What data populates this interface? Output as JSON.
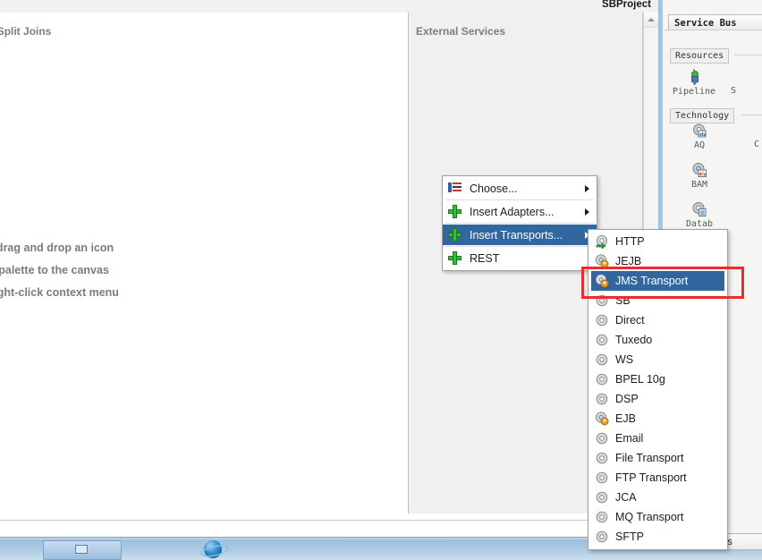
{
  "window": {
    "title": "SBProject"
  },
  "search": {
    "icon": "search-icon",
    "value": "",
    "placeholder": ""
  },
  "editor": {
    "left_column": {
      "header": "pelines/Split Joins",
      "hints": [
        "ources, drag and drop an icon",
        "mponent palette to the canvas",
        "om the right-click context menu"
      ]
    },
    "right_column": {
      "header": "External Services"
    }
  },
  "palette": {
    "tab": "Service Bus",
    "groups": [
      {
        "label": "Resources",
        "items": [
          {
            "name": "Pipeline",
            "icon": "pipeline-icon"
          },
          {
            "name": "S",
            "icon": "split-join-icon"
          }
        ]
      },
      {
        "label": "Technology",
        "items": [
          {
            "name": "AQ",
            "icon": "aq-gear-icon"
          },
          {
            "name": "C",
            "icon": "coherence-gear-icon"
          },
          {
            "name": "BAM",
            "icon": "bam-gear-icon"
          },
          {
            "name": "Datab",
            "icon": "database-gear-icon"
          }
        ]
      }
    ]
  },
  "context_menu": {
    "items": [
      {
        "label": "Choose...",
        "icon": "choose-list-icon",
        "has_submenu": true,
        "selected": false
      },
      {
        "label": "Insert Adapters...",
        "icon": "green-plus-icon",
        "has_submenu": true,
        "selected": false
      },
      {
        "label": "Insert Transports...",
        "icon": "green-plus-icon",
        "has_submenu": true,
        "selected": true
      },
      {
        "label": "REST",
        "icon": "green-plus-icon",
        "has_submenu": false,
        "selected": false
      }
    ]
  },
  "submenu": {
    "title": "Insert Transports",
    "items": [
      {
        "label": "HTTP",
        "icon": "gear-green-arrow-icon",
        "selected": false
      },
      {
        "label": "JEJB",
        "icon": "gear-badge-icon",
        "selected": false
      },
      {
        "label": "JMS Transport",
        "icon": "gear-badge-icon",
        "selected": true
      },
      {
        "label": "SB",
        "icon": "gear-icon",
        "selected": false
      },
      {
        "label": "Direct",
        "icon": "gear-icon",
        "selected": false
      },
      {
        "label": "Tuxedo",
        "icon": "gear-icon",
        "selected": false
      },
      {
        "label": "WS",
        "icon": "gear-icon",
        "selected": false
      },
      {
        "label": "BPEL 10g",
        "icon": "gear-icon",
        "selected": false
      },
      {
        "label": "DSP",
        "icon": "gear-icon",
        "selected": false
      },
      {
        "label": "EJB",
        "icon": "gear-badge-icon",
        "selected": false
      },
      {
        "label": "Email",
        "icon": "gear-icon",
        "selected": false
      },
      {
        "label": "File Transport",
        "icon": "gear-icon",
        "selected": false
      },
      {
        "label": "FTP Transport",
        "icon": "gear-icon",
        "selected": false
      },
      {
        "label": "JCA",
        "icon": "gear-icon",
        "selected": false
      },
      {
        "label": "MQ Transport",
        "icon": "gear-icon",
        "selected": false
      },
      {
        "label": "SFTP",
        "icon": "gear-icon",
        "selected": false
      }
    ]
  },
  "annotation": {
    "type": "red-rectangle",
    "target": "JMS Transport",
    "color": "#ef2b2b"
  },
  "bottom_button": {
    "label": "ons"
  },
  "colors": {
    "menu_highlight": "#31679e",
    "annotation_red": "#ef2b2b",
    "plus_green": "#36bd36",
    "taskbar_blue": "#9fc0de"
  }
}
